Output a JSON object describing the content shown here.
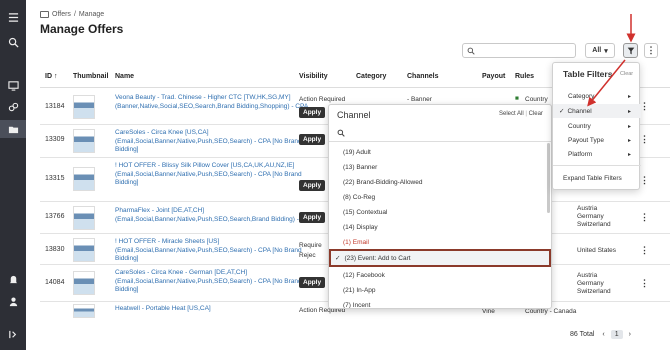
{
  "breadcrumb": {
    "parent": "Offers",
    "sep": "/",
    "current": "Manage"
  },
  "page_title": "Manage Offers",
  "toolbar": {
    "search_placeholder": "",
    "all_label": "All"
  },
  "columns": {
    "id": "ID ↑",
    "thumbnail": "Thumbnail",
    "name": "Name",
    "visibility": "Visibility",
    "category": "Category",
    "channels": "Channels",
    "payout": "Payout",
    "rules": "Rules"
  },
  "rows": [
    {
      "id": "13184",
      "name": "Veona Beauty - Trad. Chinese - Higher CTC [TW,HK,SG,MY] (Banner,Native,Social,SEO,Search,Brand Bidding,Shopping) - CPA",
      "vis": "Action Required",
      "apply": "Apply",
      "channel": "- Banner",
      "geo": "Country"
    },
    {
      "id": "13309",
      "name": "CareSoles - Circa Knee [US,CA] (Email,Social,Banner,Native,Push,SEO,Search) - CPA [No Brand Bidding]",
      "apply": "Apply"
    },
    {
      "id": "13315",
      "name": "! HOT OFFER - Blissy Silk Pillow Cover [US,CA,UK,AU,NZ,IE] (Email,Social,Banner,Native,Push,SEO,Search) - CPA [No Brand Bidding]",
      "apply": "Apply"
    },
    {
      "id": "13766",
      "name": "PharmaFlex - Joint [DE,AT,CH] (Email,Social,Banner,Native,Push,SEO,Search,Brand Bidding) - CPA",
      "apply": "Apply",
      "geo": [
        "Austria",
        "Germany",
        "Switzerland"
      ]
    },
    {
      "id": "13830",
      "name": "! HOT OFFER - Miracle Sheets [US] (Email,Social,Banner,Native,Push,SEO,Search) - CPA [No Brand Bidding]",
      "vis": "Require",
      "reject": "Rejec",
      "geo": "United States"
    },
    {
      "id": "14084",
      "name": "CareSoles - Circa Knee - German [DE,AT,CH] (Email,Social,Banner,Native,Push,SEO,Search) - CPA [No Brand Bidding]",
      "apply": "Apply",
      "geo": [
        "Austria",
        "Germany",
        "Switzerland"
      ]
    },
    {
      "id": "",
      "name": "Heatwell - Portable Heat [US,CA]",
      "vis": "Action Required",
      "channel": "Vine",
      "geo": "Country - Canada"
    }
  ],
  "footer": {
    "total": "86 Total",
    "page": "1"
  },
  "channel_dropdown": {
    "title": "Channel",
    "select_all": "Select All",
    "clear": "Clear",
    "options": [
      {
        "label": "(19) Adult"
      },
      {
        "label": "(13) Banner"
      },
      {
        "label": "(22) Brand-Bidding-Allowed"
      },
      {
        "label": "(8) Co-Reg"
      },
      {
        "label": "(15) Contextual"
      },
      {
        "label": "(14) Display"
      },
      {
        "label": "(1) Email"
      },
      {
        "label": "(23) Event: Add to Cart",
        "selected": true
      },
      {
        "label": "(12) Facebook"
      },
      {
        "label": "(21) In-App"
      },
      {
        "label": "(7) Incent"
      }
    ]
  },
  "table_filters": {
    "title": "Table Filters",
    "clear": "Clear",
    "items": [
      {
        "label": "Category"
      },
      {
        "label": "Channel",
        "selected": true
      },
      {
        "label": "Country"
      },
      {
        "label": "Payout Type"
      },
      {
        "label": "Platform"
      }
    ],
    "expand": "Expand Table Filters"
  },
  "colors": {
    "rail": "#2d2f36",
    "link": "#2f6fb0",
    "annotation": "#d0312d",
    "highlight_border": "#8b3a2b"
  }
}
